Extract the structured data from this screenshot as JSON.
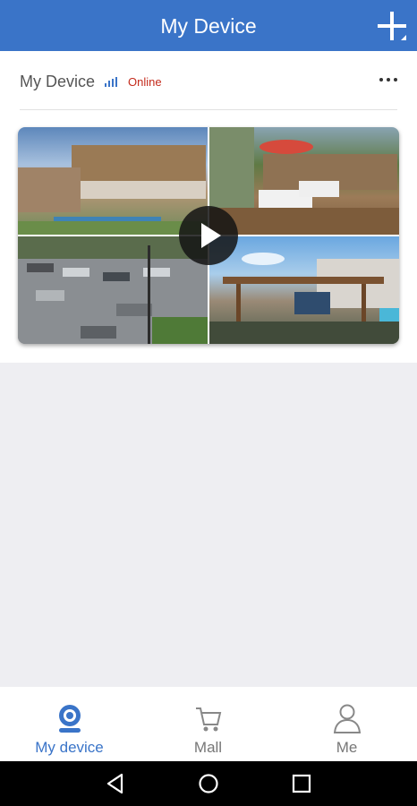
{
  "header": {
    "title": "My Device"
  },
  "device": {
    "name": "My Device",
    "status": "Online"
  },
  "colors": {
    "accent": "#3a74c8",
    "status_online": "#c42b1c",
    "background": "#eeeef2"
  },
  "icons": {
    "add": "plus-icon",
    "signal": "signal-strength-icon",
    "more": "ellipsis-icon",
    "play": "play-icon",
    "device": "camera-icon",
    "mall": "cart-icon",
    "me": "user-icon"
  },
  "camera_feeds": [
    "camera-1",
    "camera-2",
    "camera-3",
    "camera-4"
  ],
  "tabs": [
    {
      "label": "My device",
      "active": true
    },
    {
      "label": "Mall",
      "active": false
    },
    {
      "label": "Me",
      "active": false
    }
  ],
  "android_nav": [
    "back-icon",
    "home-icon",
    "recents-icon"
  ]
}
